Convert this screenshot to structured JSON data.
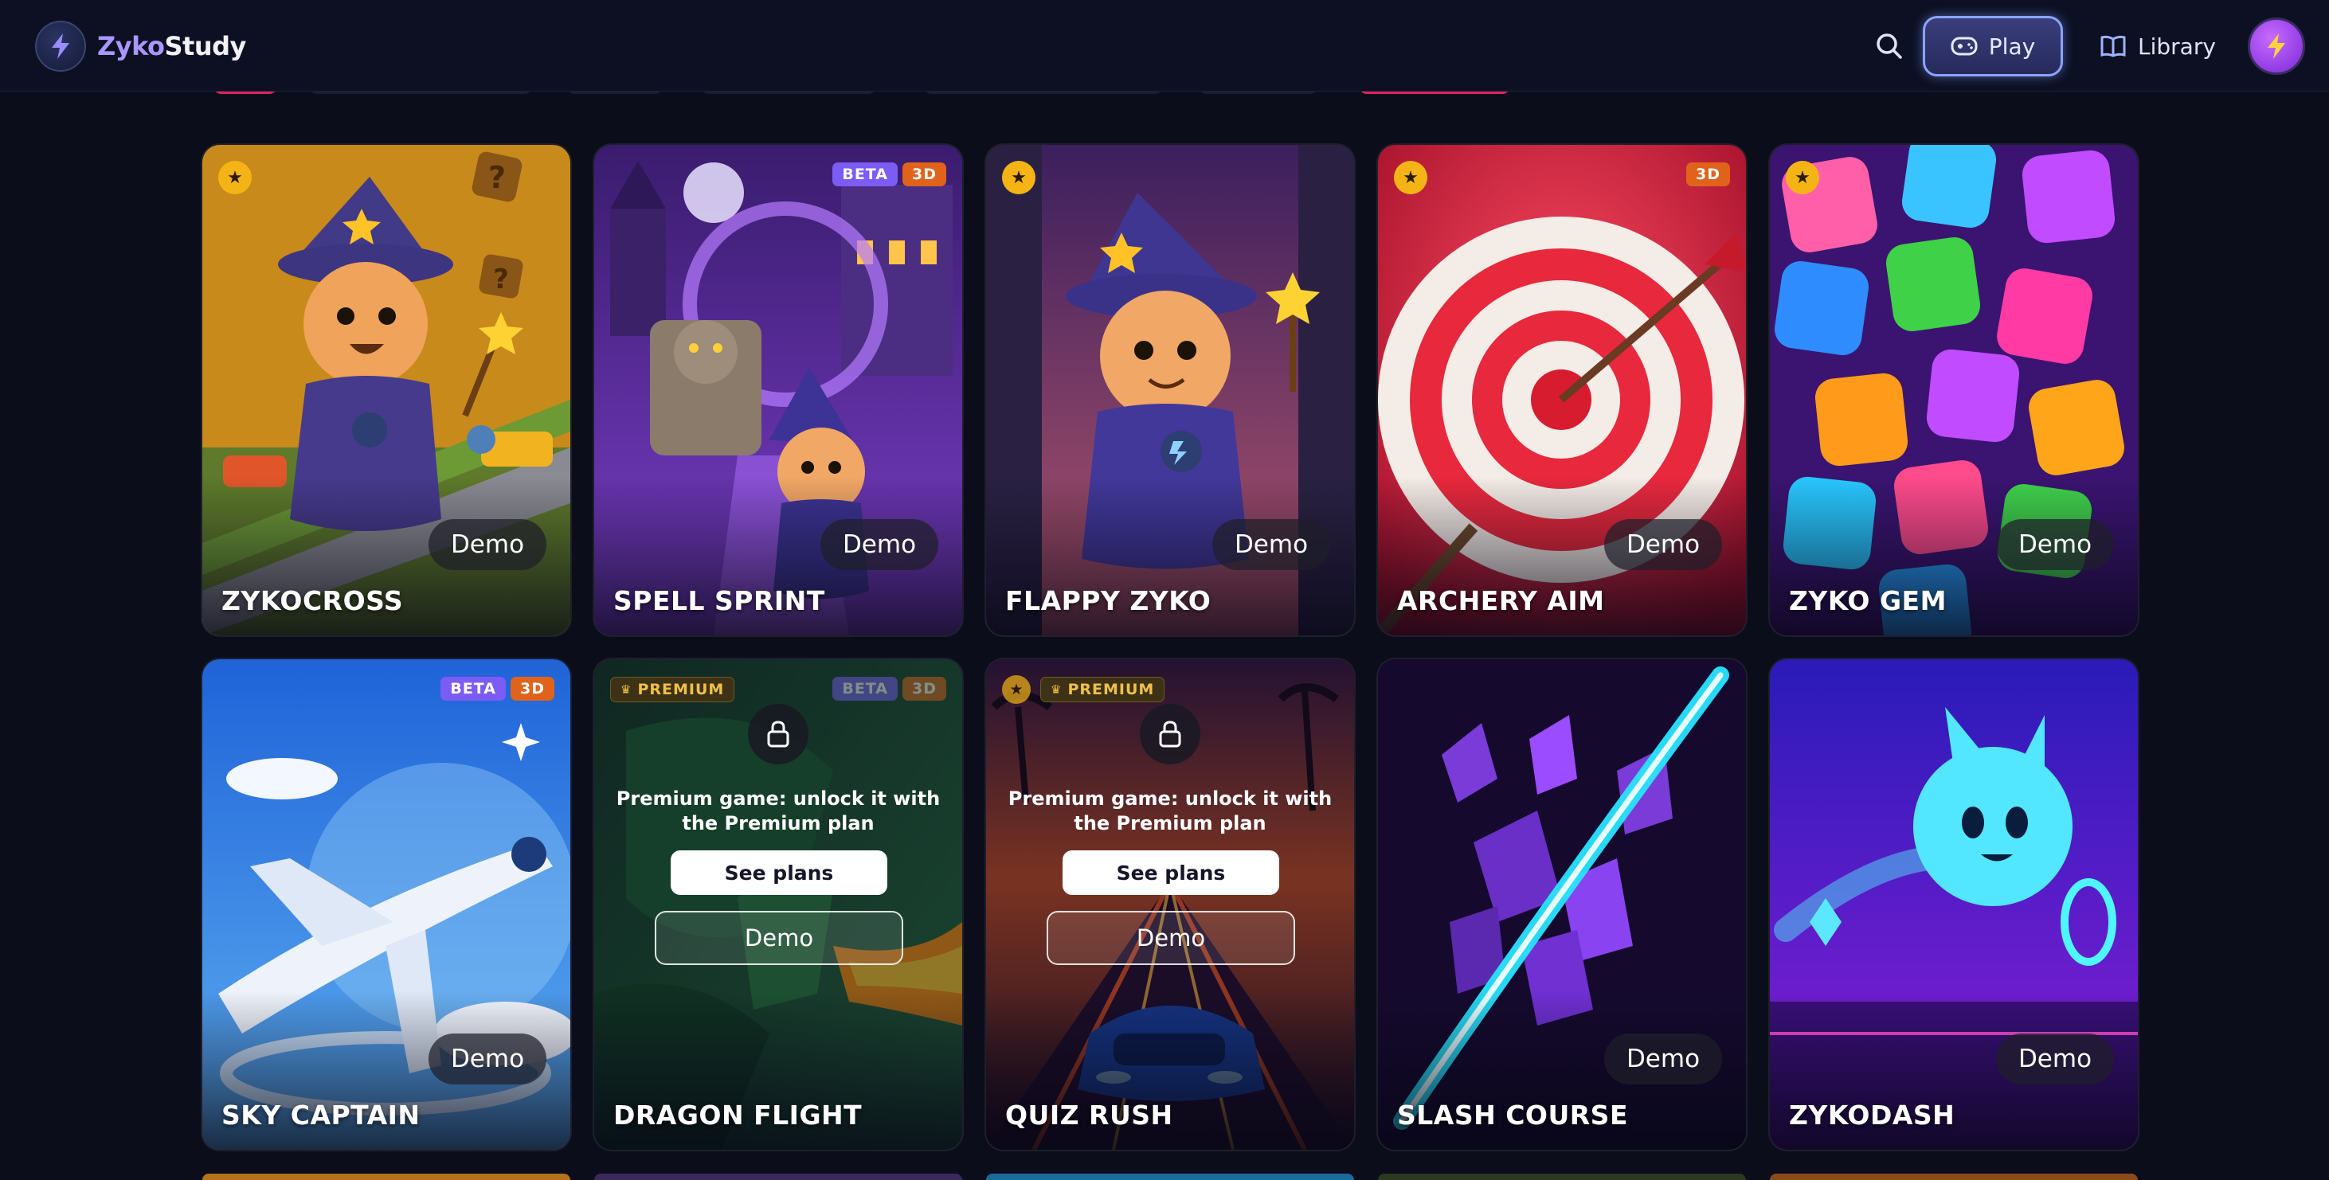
{
  "app": {
    "brand_a": "Zyko",
    "brand_b": "Study"
  },
  "header": {
    "play_label": "Play",
    "library_label": "Library"
  },
  "games": [
    {
      "title": "ZYKOCROSS",
      "demo": "Demo",
      "star": true,
      "tags": []
    },
    {
      "title": "SPELL SPRINT",
      "demo": "Demo",
      "star": false,
      "tags": [
        "BETA",
        "3D"
      ]
    },
    {
      "title": "FLAPPY ZYKO",
      "demo": "Demo",
      "star": true,
      "tags": []
    },
    {
      "title": "ARCHERY AIM",
      "demo": "Demo",
      "star": true,
      "tags": [
        "3D"
      ]
    },
    {
      "title": "ZYKO GEM",
      "demo": "Demo",
      "star": true,
      "tags": []
    },
    {
      "title": "SKY CAPTAIN",
      "demo": "Demo",
      "star": false,
      "tags": [
        "BETA",
        "3D"
      ]
    },
    {
      "title": "DRAGON FLIGHT",
      "demo": "Demo",
      "star": false,
      "premium": "PREMIUM",
      "tags": [
        "BETA",
        "3D"
      ],
      "locked_text": "Premium game: unlock it with the Premium plan",
      "plans_label": "See plans"
    },
    {
      "title": "QUIZ RUSH",
      "demo": "Demo",
      "star": true,
      "premium": "PREMIUM",
      "tags": [],
      "locked_text": "Premium game: unlock it with the Premium plan",
      "plans_label": "See plans"
    },
    {
      "title": "SLASH COURSE",
      "demo": "Demo",
      "star": false,
      "tags": []
    },
    {
      "title": "ZYKODASH",
      "demo": "Demo",
      "star": false,
      "tags": []
    }
  ],
  "icons": {
    "logo": "bolt-icon",
    "search": "search-icon",
    "play": "gamepad-icon",
    "library": "book-icon",
    "avatar": "bolt-icon",
    "star": "star-icon",
    "lock": "lock-icon"
  },
  "colors": {
    "background": "#0b0d1a",
    "accent": "#8aa4ff",
    "beta": "#7b5cf5",
    "tag_3d": "#e0631c",
    "star": "#f4b416",
    "premium": "#f0c04a"
  }
}
